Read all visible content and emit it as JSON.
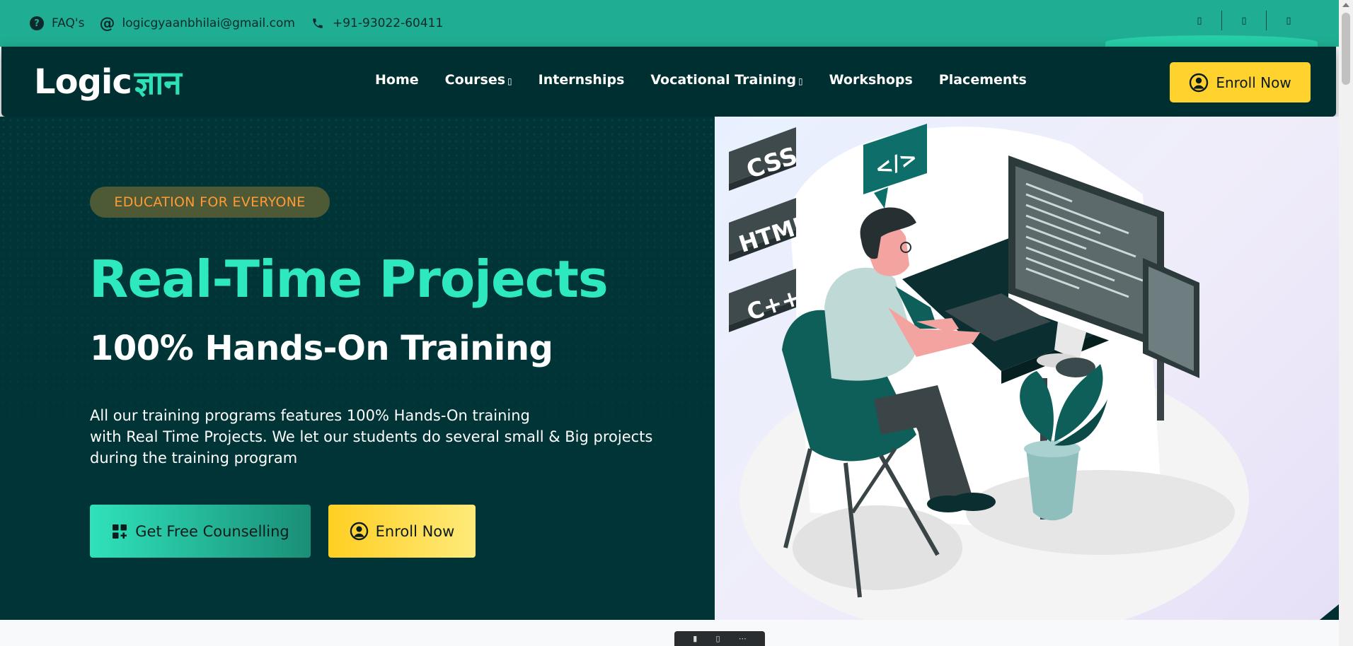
{
  "topbar": {
    "faq_label": "FAQ's",
    "email": "logicgyaanbhilai@gmail.com",
    "phone": "+91-93022-60411",
    "social_icons": [
      "social-icon-1",
      "social-icon-2",
      "social-icon-3"
    ],
    "social_glyph": "▯"
  },
  "nav": {
    "logo_en": "Logic",
    "logo_hi": "ज्ञान",
    "links": [
      {
        "label": "Home",
        "caret": ""
      },
      {
        "label": "Courses",
        "caret": "▯"
      },
      {
        "label": "Internships",
        "caret": ""
      },
      {
        "label": "Vocational Training",
        "caret": "▯"
      },
      {
        "label": "Workshops",
        "caret": ""
      },
      {
        "label": "Placements",
        "caret": ""
      }
    ],
    "enroll_label": "Enroll Now"
  },
  "hero": {
    "badge": "EDUCATION FOR EVERYONE",
    "title": "Real-Time Projects",
    "subtitle": "100% Hands-On Training",
    "description_lines": [
      "All our training programs features 100% Hands-On training",
      "with Real Time Projects. We let our students do several small & Big projects",
      "during the training program"
    ],
    "counselling_label": "Get Free Counselling",
    "enroll_label": "Enroll Now",
    "illustration_tags": [
      "CSS",
      "HTML",
      "C++",
      "</>"
    ]
  },
  "colors": {
    "topbar_bg": "#1fae93",
    "navbar_bg": "#002f31",
    "hero_bg": "#013436",
    "accent_teal": "#2ee8c0",
    "accent_yellow": "#ffd22e",
    "badge_text": "#ff9b36"
  }
}
